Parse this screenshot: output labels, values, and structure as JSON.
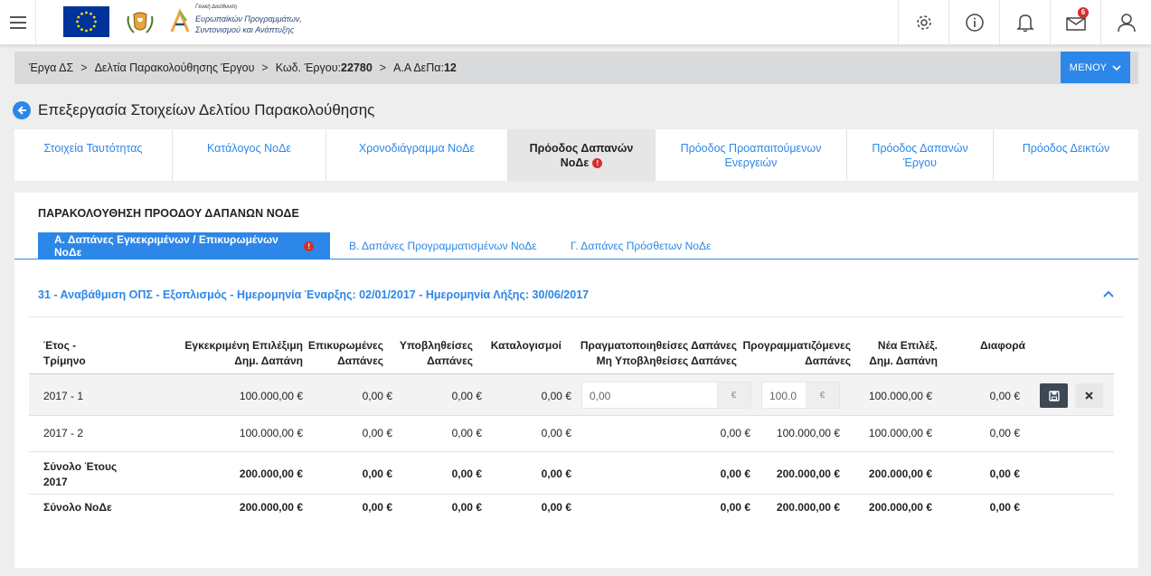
{
  "header": {
    "logo_small": "Γενική Διεύθυνση",
    "logo_line1": "Ευρωπαϊκών Προγραμμάτων,",
    "logo_line2": "Συντονισμού και Ανάπτυξης",
    "notifications_badge": "6",
    "icons": [
      "menu-icon",
      "settings-icon",
      "info-icon",
      "bell-icon",
      "mail-icon",
      "user-icon"
    ]
  },
  "breadcrumb": {
    "item1": "Έργα ΔΣ",
    "item2": "Δελτία Παρακολούθησης Έργου",
    "item3_label": "Κωδ. Έργου: ",
    "item3_value": "22780",
    "item4_label": "Α.Α ΔεΠα: ",
    "item4_value": "12",
    "menu_label": "ΜΕΝΟΥ"
  },
  "page": {
    "title": "Επεξεργασία Στοιχείων Δελτίου Παρακολούθησης"
  },
  "main_tabs": [
    {
      "line1": "Στοιχεία Ταυτότητας",
      "line2": ""
    },
    {
      "line1": "Κατάλογος ΝοΔε",
      "line2": ""
    },
    {
      "line1": "Χρονοδιάγραμμα ΝοΔε",
      "line2": ""
    },
    {
      "line1": "Πρόοδος Δαπανών",
      "line2": "ΝοΔε"
    },
    {
      "line1": "Πρόοδος Προαπαιτούμενων",
      "line2": "Ενεργειών"
    },
    {
      "line1": "Πρόοδος Δαπανών",
      "line2": "Έργου"
    },
    {
      "line1": "Πρόοδος Δεικτών",
      "line2": ""
    }
  ],
  "card": {
    "title": "ΠΑΡΑΚΟΛΟΥΘΗΣΗ ΠΡΟΟΔΟΥ ΔΑΠΑΝΩΝ ΝΟΔΕ",
    "sub_tabs": [
      "Α. Δαπάνες Εγκεκριμένων / Επικυρωμένων ΝοΔε",
      "Β. Δαπάνες Προγραμματισμένων ΝοΔε",
      "Γ. Δαπάνες Πρόσθετων ΝοΔε"
    ],
    "section_title": "31 - Αναβάθμιση ΟΠΣ - Εξοπλισμός - Ημερομηνία Έναρξης: 02/01/2017 - Ημερομηνία Λήξης: 30/06/2017"
  },
  "table": {
    "headers": [
      {
        "l1": "Έτος -",
        "l2": "Τρίμηνο"
      },
      {
        "l1": "Εγκεκριμένη Επιλέξιμη",
        "l2": "Δημ. Δαπάνη"
      },
      {
        "l1": "Επικυρωμένες",
        "l2": "Δαπάνες"
      },
      {
        "l1": "Υποβληθείσες",
        "l2": "Δαπάνες"
      },
      {
        "l1": "Καταλογισμοί",
        "l2": ""
      },
      {
        "l1": "Πραγματοποιηθείσες Δαπάνες",
        "l2": "Μη Υποβληθείσες Δαπάνες"
      },
      {
        "l1": "Προγραμματιζόμενες",
        "l2": "Δαπάνες"
      },
      {
        "l1": "Νέα Επιλέξ.",
        "l2": "Δημ. Δαπάνη"
      },
      {
        "l1": "Διαφορά",
        "l2": ""
      }
    ],
    "edit_row": {
      "period": "2017 - 1",
      "approved": "100.000,00 €",
      "validated": "0,00 €",
      "submitted": "0,00 €",
      "charges": "0,00 €",
      "realized_input": "0,00",
      "planned_input": "100.0",
      "currency": "€",
      "new_eligible": "100.000,00 €",
      "difference": "0,00 €"
    },
    "rows": [
      {
        "period": "2017 - 2",
        "approved": "100.000,00 €",
        "validated": "0,00 €",
        "submitted": "0,00 €",
        "charges": "0,00 €",
        "realized": "0,00 €",
        "planned": "100.000,00 €",
        "new_eligible": "100.000,00 €",
        "difference": "0,00 €"
      }
    ],
    "year_total": {
      "label1": "Σύνολο Έτους",
      "label2": "2017",
      "approved": "200.000,00 €",
      "validated": "0,00 €",
      "submitted": "0,00 €",
      "charges": "0,00 €",
      "realized": "0,00 €",
      "planned": "200.000,00 €",
      "new_eligible": "200.000,00 €",
      "difference": "0,00 €"
    },
    "node_total": {
      "label": "Σύνολο ΝοΔε",
      "approved": "200.000,00 €",
      "validated": "0,00 €",
      "submitted": "0,00 €",
      "charges": "0,00 €",
      "realized": "0,00 €",
      "planned": "200.000,00 €",
      "new_eligible": "200.000,00 €",
      "difference": "0,00 €"
    }
  },
  "colors": {
    "accent": "#2c87e8",
    "error": "#d32f2f",
    "dark_button": "#3d4854"
  }
}
